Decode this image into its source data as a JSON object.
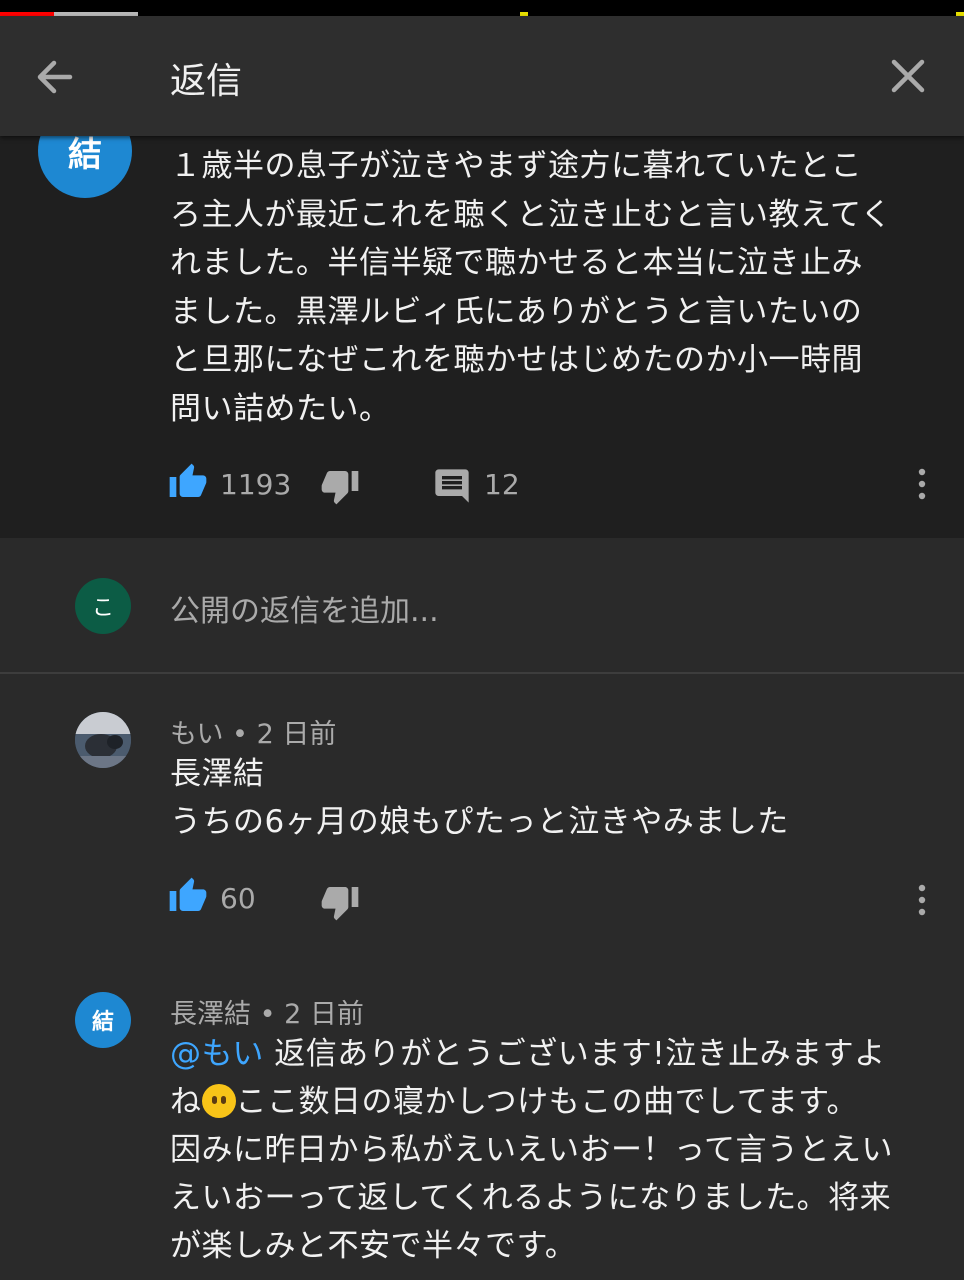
{
  "header": {
    "title": "返信"
  },
  "parent_comment": {
    "avatar_initial": "結",
    "text_lines": [
      "１歳半の息子が泣きやまず途方に暮れていたとこ",
      "ろ主人が最近これを聴くと泣き止むと言い教えてく",
      "れました。半信半疑で聴かせると本当に泣き止み",
      "ました。黒澤ルビィ氏にありがとうと言いたいの",
      "と旦那になぜこれを聴かせはじめたのか小一時間",
      "問い詰めたい。"
    ],
    "like_count": "1193",
    "reply_count": "12"
  },
  "add_reply": {
    "avatar_initial": "こ",
    "placeholder": "公開の返信を追加..."
  },
  "replies": [
    {
      "author": "もい",
      "time": "2 日前",
      "text_lines": [
        "長澤結",
        "うちの6ヶ月の娘もぴたっと泣きやみました"
      ],
      "like_count": "60"
    },
    {
      "author": "長澤結",
      "avatar_initial": "結",
      "time": "2 日前",
      "mention": "@もい",
      "line1_rest": " 返信ありがとうございます!泣き止みますよ",
      "line2_a": "ね",
      "line2_b": "ここ数日の寝かしつけもこの曲でしてます。",
      "line3": "因みに昨日から私がえいえいおー！って言うとえい",
      "line4": "えいおーって返してくれるようになりました。将来",
      "line5": "が楽しみと不安で半々です。"
    }
  ],
  "meta_separator": " • ",
  "colors": {
    "like_blue": "#3ea6ff",
    "icon_gray": "#aaaaaa",
    "parent_avatar": "#1e88d2",
    "my_avatar": "#0c5c45"
  },
  "icons": {
    "back": "arrow-left-icon",
    "close": "close-icon",
    "like": "thumbs-up-icon",
    "dislike": "thumbs-down-icon",
    "reply": "comment-icon",
    "more": "more-vertical-icon"
  }
}
